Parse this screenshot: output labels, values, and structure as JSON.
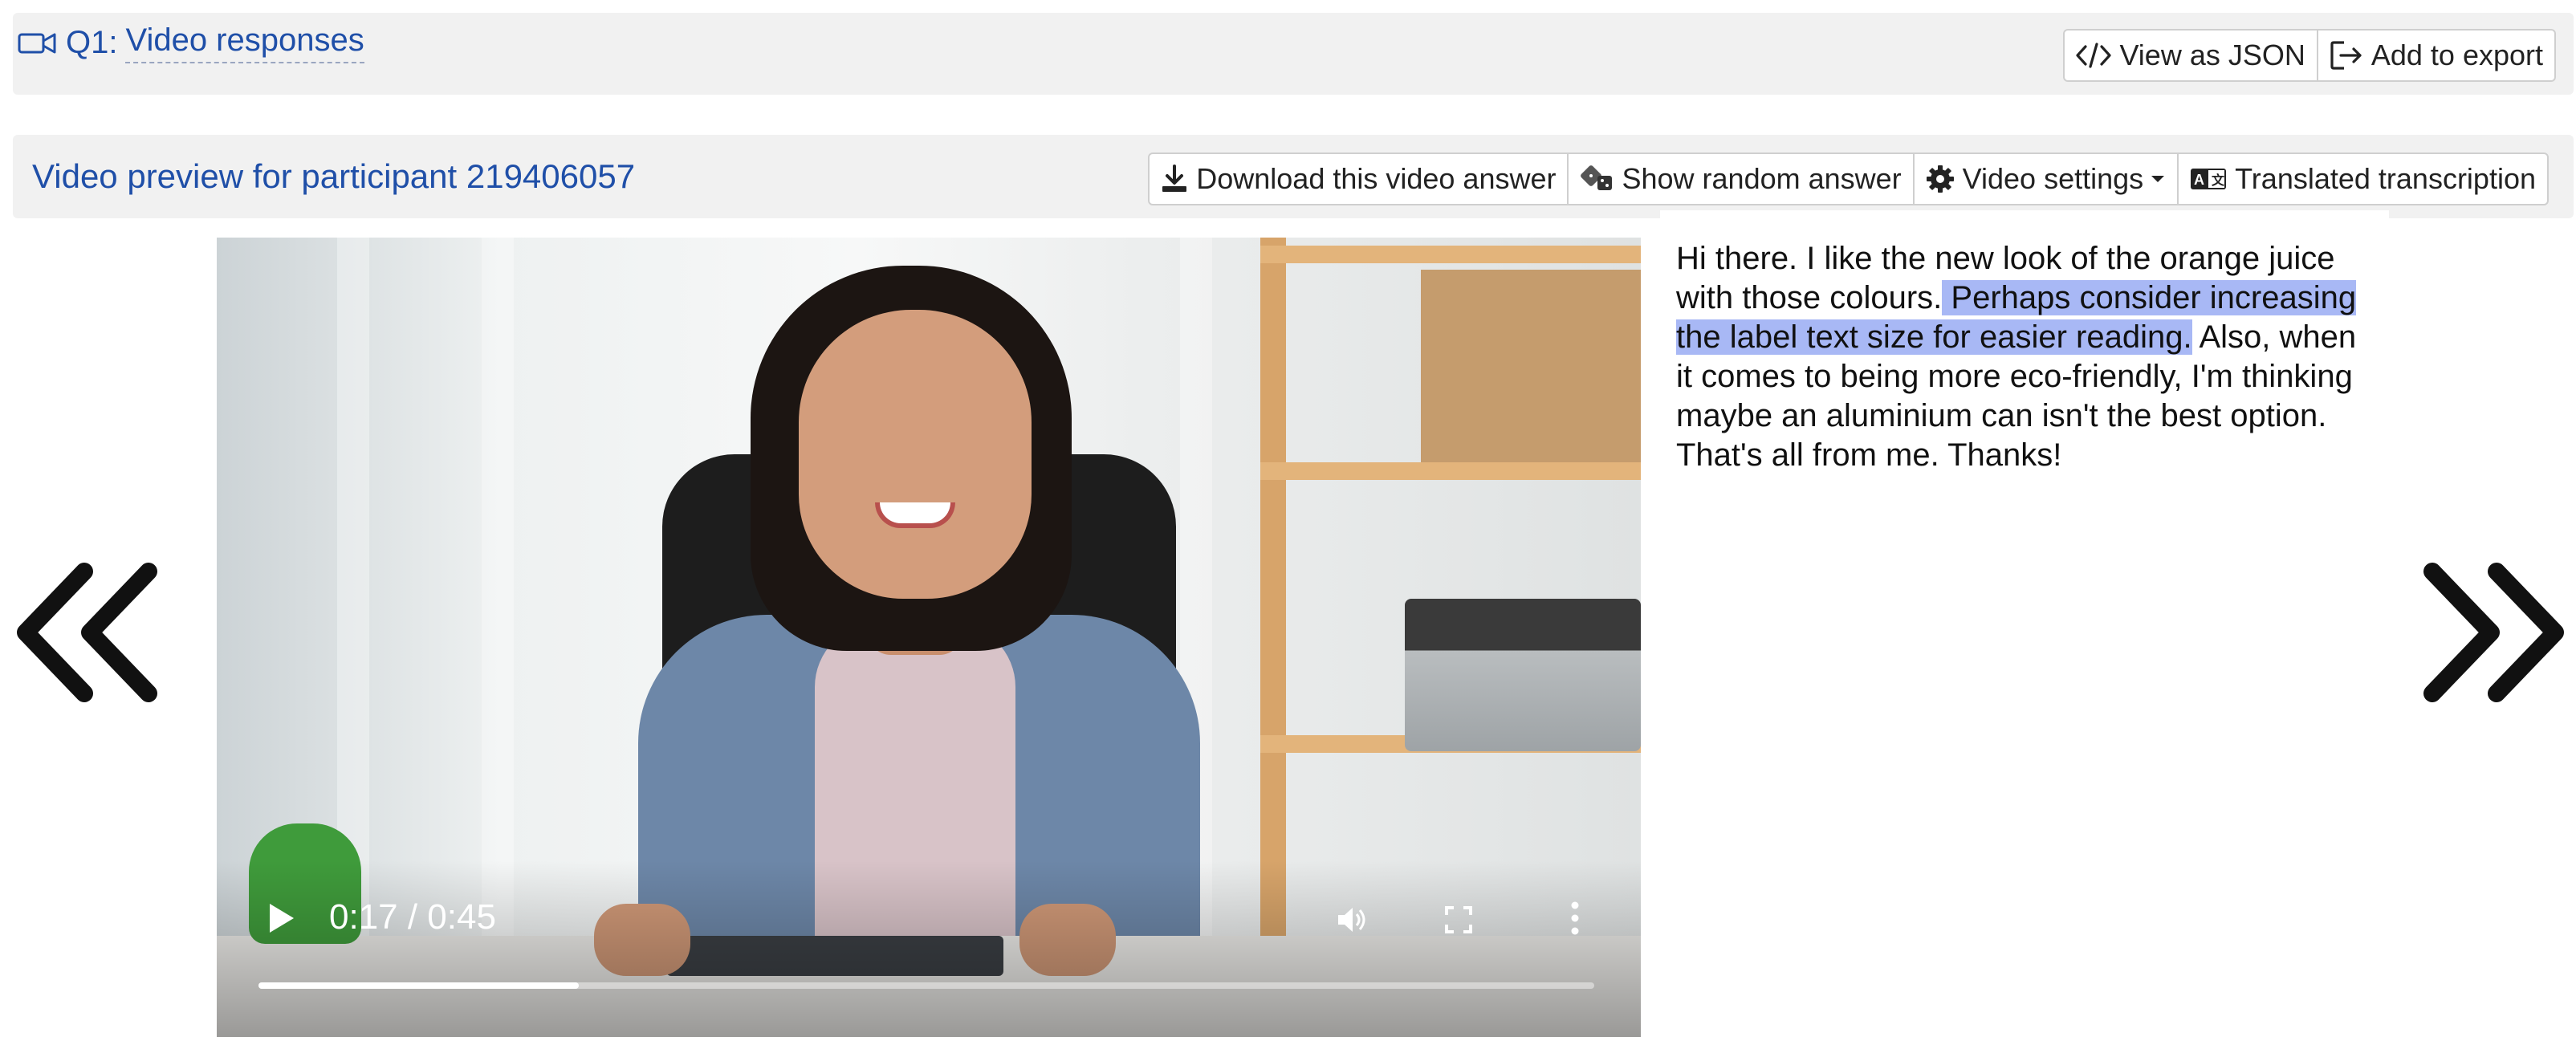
{
  "question": {
    "number": "Q1:",
    "title": "Video responses",
    "view_json_label": "View as JSON",
    "add_export_label": "Add to export"
  },
  "preview": {
    "title": "Video preview for participant 219406057",
    "download_label": "Download this video answer",
    "random_label": "Show random answer",
    "settings_label": "Video settings",
    "translated_label": "Translated transcription"
  },
  "video": {
    "time_display": "0:17 / 0:45",
    "progress_fraction": 0.24
  },
  "transcript": {
    "before": "Hi there. I like the new look of the orange juice with those colours.",
    "highlighted": " Perhaps consider increasing the label text size for easier reading.",
    "after": " Also, when it comes to being more eco-friendly, I'm thinking maybe an aluminium can isn't the best option. That's all from me. Thanks!"
  },
  "icons": {
    "question_type": "video-camera-icon",
    "view_json": "code-icon",
    "add_export": "export-icon",
    "download": "download-icon",
    "random": "dice-icon",
    "settings": "gear-icon",
    "translate": "translate-icon",
    "prev": "double-chevron-left-icon",
    "next": "double-chevron-right-icon"
  },
  "colors": {
    "link_blue": "#1f4fa8",
    "highlight": "#a8b8f5",
    "bar_background": "#f1f1f1"
  }
}
